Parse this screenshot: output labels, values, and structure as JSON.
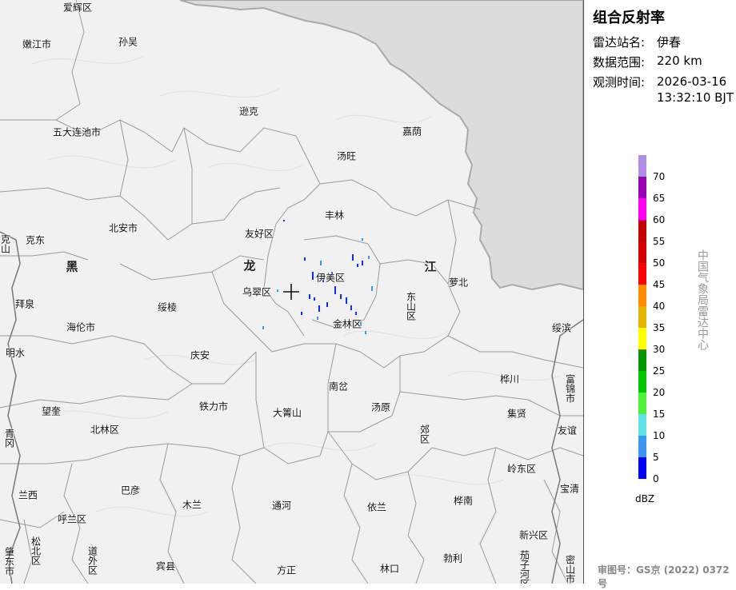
{
  "panel": {
    "title": "组合反射率",
    "station_label": "雷达站名:",
    "station_value": "伊春",
    "range_label": "数据范围:",
    "range_value": "220 km",
    "time_label": "观测时间:",
    "time_date": "2026-03-16",
    "time_clock": "13:32:10 BJT",
    "watermark": "中国气象局雷达中心",
    "approval": "审图号：GS京 (2022) 0372号"
  },
  "legend": {
    "unit": "dBZ",
    "ticks": [
      "70",
      "65",
      "60",
      "55",
      "50",
      "45",
      "40",
      "35",
      "30",
      "25",
      "20",
      "15",
      "10",
      "5",
      "0"
    ],
    "colors": [
      "#b18ee6",
      "#9a00b4",
      "#ff00f0",
      "#c40000",
      "#d60000",
      "#ff0000",
      "#ff8c00",
      "#e6b400",
      "#ffff00",
      "#009600",
      "#00c800",
      "#4ef03c",
      "#5de0e6",
      "#3c96f0",
      "#0000f6"
    ]
  },
  "map": {
    "province_label_1": "黑",
    "province_label_2": "龙",
    "province_label_3": "江",
    "places": {
      "aihui": "爱辉区",
      "nenjiang": "嫩江市",
      "sunwu": "孙吴",
      "xunke": "逊克",
      "wudalianchi": "五大连池市",
      "jiayin": "嘉荫",
      "tangwang": "汤旺",
      "fenglin": "丰林",
      "youhao": "友好区",
      "beian": "北安市",
      "ke": "克东",
      "kedge": "克山",
      "luobei": "萝北",
      "yimei": "伊美区",
      "wucui": "乌翠区",
      "dongshan": "东山区",
      "jinlin": "金林区",
      "suiling": "绥棱",
      "baiquan": "拜泉",
      "hailun": "海伦市",
      "suibin": "绥滨",
      "mingshui": "明水",
      "qingan": "庆安",
      "huachuan": "桦川",
      "fujin": "富锦市",
      "nancha": "南岔",
      "tieli": "铁力市",
      "dajingshan": "大箐山",
      "tangyuan": "汤原",
      "wangkui": "望奎",
      "jixian": "集贤",
      "qinggang": "青冈",
      "beilin": "北林区",
      "jiaoqu": "郊区",
      "youyi": "友谊",
      "lingdong": "岭东区",
      "lanxi": "兰西",
      "bayan": "巴彦",
      "mulan": "木兰",
      "tonghe": "通河",
      "yilan": "依兰",
      "huanan": "桦南",
      "baoqing": "宝清",
      "hulan": "呼兰区",
      "xinxing": "新兴区",
      "songbei": "松北区",
      "daowai": "道外区",
      "zhaodong": "肇东市",
      "binxian": "宾县",
      "fangzheng": "方正",
      "linkou": "林口",
      "boli": "勃利",
      "qiezihe": "茄子河区",
      "mishan": "密山市"
    }
  },
  "colors": {
    "land": "#f1f1f1",
    "russia": "#dedede",
    "border": "#999999",
    "radar_echo": "#0a2cff"
  }
}
